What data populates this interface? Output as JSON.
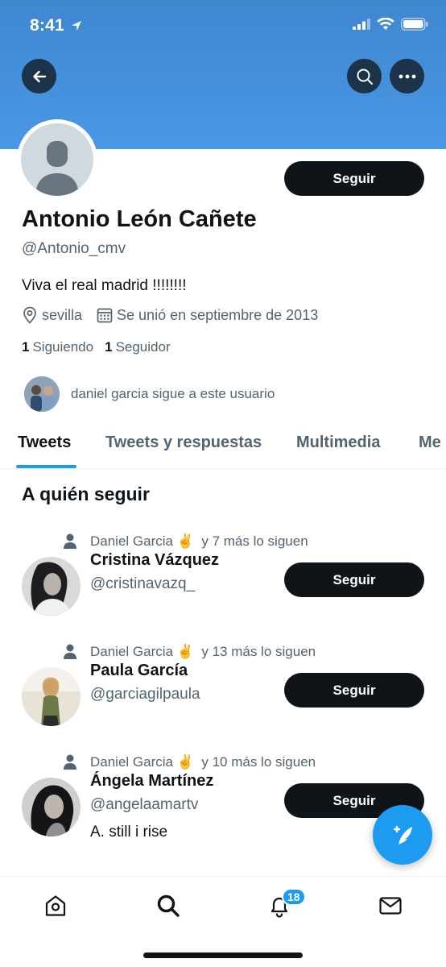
{
  "status_bar": {
    "time": "8:41"
  },
  "profile": {
    "name": "Antonio León Cañete",
    "handle": "@Antonio_cmv",
    "bio": "Viva el real madrid !!!!!!!!",
    "location": "sevilla",
    "joined": "Se unió en septiembre de 2013",
    "following_count": "1",
    "following_label": "Siguiendo",
    "followers_count": "1",
    "followers_label": "Seguidor",
    "followed_by_text": "daniel garcia sigue a este usuario",
    "follow_button": "Seguir"
  },
  "tabs": [
    {
      "label": "Tweets",
      "active": true
    },
    {
      "label": "Tweets y respuestas",
      "active": false
    },
    {
      "label": "Multimedia",
      "active": false
    },
    {
      "label": "Me",
      "active": false
    }
  ],
  "who_to_follow": {
    "title": "A quién seguir",
    "items": [
      {
        "context_name": "Daniel Garcia",
        "context_emoji": "✌️",
        "context_rest": "y 7 más lo siguen",
        "name": "Cristina Vázquez",
        "handle": "@cristinavazq_",
        "bio": "",
        "button": "Seguir"
      },
      {
        "context_name": "Daniel Garcia",
        "context_emoji": "✌️",
        "context_rest": "y 13 más lo siguen",
        "name": "Paula García",
        "handle": "@garciagilpaula",
        "bio": "",
        "button": "Seguir"
      },
      {
        "context_name": "Daniel Garcia",
        "context_emoji": "✌️",
        "context_rest": "y 10 más lo siguen",
        "name": "Ángela Martínez",
        "handle": "@angelaamartv",
        "bio": "A. still i rise",
        "button": "Seguir"
      }
    ]
  },
  "bottom_nav": {
    "items": [
      "home-icon",
      "search-icon",
      "notifications-icon",
      "messages-icon"
    ],
    "notification_badge": "18"
  },
  "colors": {
    "accent": "#1d9bf0",
    "banner": "#4a97e6",
    "dark_button": "#0f1419"
  }
}
